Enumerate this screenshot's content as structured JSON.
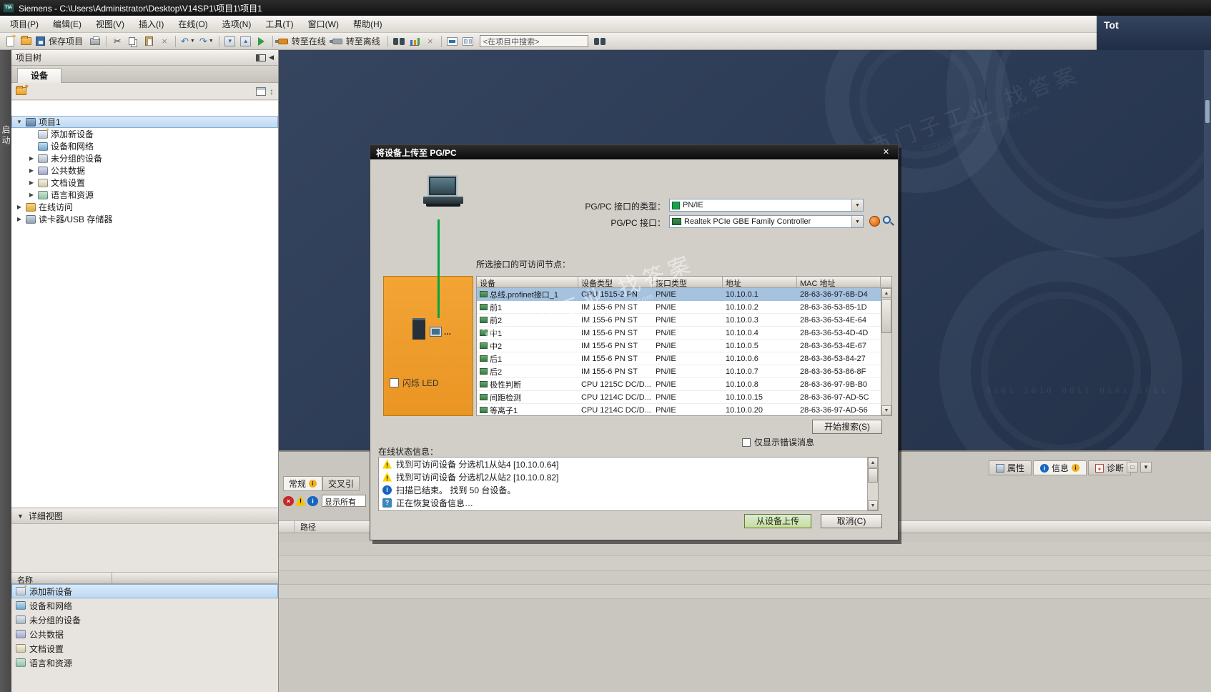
{
  "titlebar": {
    "title": "Siemens  -  C:\\Users\\Administrator\\Desktop\\V14SP1\\项目1\\项目1",
    "portal_text": "Tot"
  },
  "menubar": [
    "项目(P)",
    "编辑(E)",
    "视图(V)",
    "插入(I)",
    "在线(O)",
    "选项(N)",
    "工具(T)",
    "窗口(W)",
    "帮助(H)"
  ],
  "toolbar": {
    "save_label": "保存项目",
    "go_online_label": "转至在线",
    "go_offline_label": "转至离线",
    "search_placeholder": "<在项目中搜索>"
  },
  "nav_strip": {
    "label": "启动"
  },
  "project_tree": {
    "header": "项目树",
    "tab_label": "设备",
    "items": [
      {
        "label": "项目1",
        "level": 0,
        "expander": "collapse",
        "icon": "project",
        "selected": true
      },
      {
        "label": "添加新设备",
        "level": 1,
        "expander": "none",
        "icon": "add-device",
        "selected": false
      },
      {
        "label": "设备和网络",
        "level": 1,
        "expander": "none",
        "icon": "network",
        "selected": false
      },
      {
        "label": "未分组的设备",
        "level": 1,
        "expander": "expand",
        "icon": "station",
        "selected": false
      },
      {
        "label": "公共数据",
        "level": 1,
        "expander": "expand",
        "icon": "common-data",
        "selected": false
      },
      {
        "label": "文档设置",
        "level": 1,
        "expander": "expand",
        "icon": "doc-settings",
        "selected": false
      },
      {
        "label": "语言和资源",
        "level": 1,
        "expander": "expand",
        "icon": "languages",
        "selected": false
      },
      {
        "label": "在线访问",
        "level": 0,
        "expander": "expand",
        "icon": "online-access",
        "selected": false
      },
      {
        "label": "读卡器/USB 存储器",
        "level": 0,
        "expander": "expand",
        "icon": "card-reader",
        "selected": false
      }
    ]
  },
  "detail_view": {
    "header": "详细视图",
    "name_column": "名称",
    "items": [
      {
        "label": "添加新设备",
        "icon": "add-device",
        "selected": true
      },
      {
        "label": "设备和网络",
        "icon": "network",
        "selected": false
      },
      {
        "label": "未分组的设备",
        "icon": "station",
        "selected": false
      },
      {
        "label": "公共数据",
        "icon": "common-data",
        "selected": false
      },
      {
        "label": "文档设置",
        "icon": "doc-settings",
        "selected": false
      },
      {
        "label": "语言和资源",
        "icon": "languages",
        "selected": false
      }
    ]
  },
  "dialog": {
    "title": "将设备上传至 PG/PC",
    "pg_pc_type_label": "PG/PC 接口的类型：",
    "pg_pc_type_value": "PN/IE",
    "pg_pc_interface_label": "PG/PC 接口：",
    "pg_pc_interface_value": "Realtek PCIe GBE Family Controller",
    "nodes_label": "所选接口的可访问节点：",
    "flash_led_label": "闪烁 LED",
    "device_table": {
      "columns": [
        "设备",
        "设备类型",
        "接口类型",
        "地址",
        "MAC 地址"
      ],
      "selected_row": 0,
      "rows": [
        [
          "总线.profinet接口_1",
          "CPU 1515-2 PN",
          "PN/IE",
          "10.10.0.1",
          "28-63-36-97-6B-D4"
        ],
        [
          "前1",
          "IM 155-6 PN ST",
          "PN/IE",
          "10.10.0.2",
          "28-63-36-53-85-1D"
        ],
        [
          "前2",
          "IM 155-6 PN ST",
          "PN/IE",
          "10.10.0.3",
          "28-63-36-53-4E-64"
        ],
        [
          "中1",
          "IM 155-6 PN ST",
          "PN/IE",
          "10.10.0.4",
          "28-63-36-53-4D-4D"
        ],
        [
          "中2",
          "IM 155-6 PN ST",
          "PN/IE",
          "10.10.0.5",
          "28-63-36-53-4E-67"
        ],
        [
          "后1",
          "IM 155-6 PN ST",
          "PN/IE",
          "10.10.0.6",
          "28-63-36-53-84-27"
        ],
        [
          "后2",
          "IM 155-6 PN ST",
          "PN/IE",
          "10.10.0.7",
          "28-63-36-53-86-8F"
        ],
        [
          "极性判断",
          "CPU 1215C DC/D...",
          "PN/IE",
          "10.10.0.8",
          "28-63-36-97-9B-B0"
        ],
        [
          "间距检测",
          "CPU 1214C DC/D...",
          "PN/IE",
          "10.10.0.15",
          "28-63-36-97-AD-5C"
        ],
        [
          "等离子1",
          "CPU 1214C DC/D...",
          "PN/IE",
          "10.10.0.20",
          "28-63-36-97-AD-56"
        ]
      ]
    },
    "start_search_button": "开始搜索(S)",
    "only_errors_label": "仅显示错误消息",
    "status_label": "在线状态信息：",
    "messages": [
      {
        "icon": "warning",
        "text": "找到可访问设备 分选机1从站4 [10.10.0.64]"
      },
      {
        "icon": "warning",
        "text": "找到可访问设备 分选机2从站2 [10.10.0.82]"
      },
      {
        "icon": "info",
        "text": "扫描已结束。 找到 50 台设备。"
      },
      {
        "icon": "query",
        "text": "正在恢复设备信息…"
      }
    ],
    "upload_button": "从设备上传",
    "cancel_button": "取消(C)"
  },
  "inspector": {
    "sub_tabs": [
      {
        "label": "常规",
        "selected": true,
        "badge": "info"
      },
      {
        "label": "交叉引",
        "selected": false
      }
    ],
    "filter_dropdown": "显示所有",
    "path_column": "路径",
    "tabs": [
      {
        "label": "属性",
        "icon": "properties",
        "selected": false
      },
      {
        "label": "信息",
        "icon": "info",
        "selected": true
      },
      {
        "label": "诊断",
        "icon": "diagnostics",
        "selected": false
      }
    ]
  },
  "watermark": {
    "text": "西门子工业 找答案",
    "subtext": "support.industry.siemens.com"
  },
  "colors": {
    "accent_orange": "#F2A435",
    "selection_blue": "#A5C2DF",
    "online_green": "#00A63C",
    "upload_button_green": "#C8DC9E",
    "workspace_dark": "#2D3C55"
  }
}
